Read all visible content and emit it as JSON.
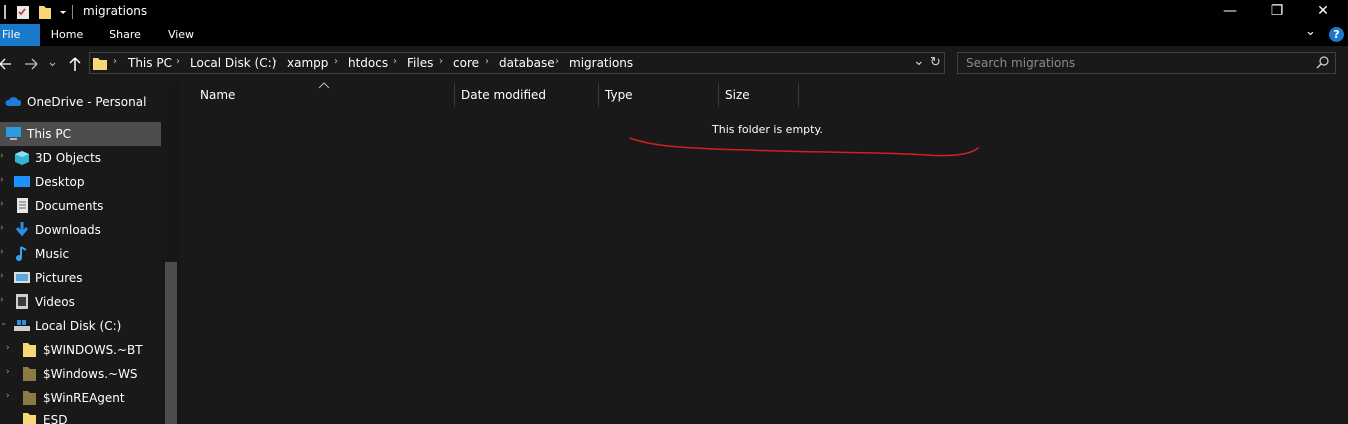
{
  "window": {
    "title": "migrations",
    "minimize": "—",
    "maximize": "❐",
    "close": "✕"
  },
  "ribbon": {
    "tabs": [
      "File",
      "Home",
      "Share",
      "View"
    ],
    "help": "?",
    "expand": "⌄"
  },
  "address": {
    "breadcrumbs": [
      "This PC",
      "Local Disk (C:)",
      "xampp",
      "htdocs",
      "Files",
      "core",
      "database",
      "migrations"
    ],
    "dropdown": "⌄",
    "refresh": "↻"
  },
  "search": {
    "placeholder": "Search migrations"
  },
  "nav": {
    "items": [
      {
        "label": "OneDrive - Personal",
        "icon": "cloud-icon"
      },
      {
        "label": "This PC",
        "icon": "computer-icon"
      },
      {
        "label": "3D Objects",
        "icon": "cube-icon"
      },
      {
        "label": "Desktop",
        "icon": "desktop-icon"
      },
      {
        "label": "Documents",
        "icon": "document-icon"
      },
      {
        "label": "Downloads",
        "icon": "download-icon"
      },
      {
        "label": "Music",
        "icon": "music-icon"
      },
      {
        "label": "Pictures",
        "icon": "picture-icon"
      },
      {
        "label": "Videos",
        "icon": "video-icon"
      },
      {
        "label": "Local Disk (C:)",
        "icon": "drive-icon"
      },
      {
        "label": "$WINDOWS.~BT",
        "icon": "folder-icon"
      },
      {
        "label": "$Windows.~WS",
        "icon": "folder-icon"
      },
      {
        "label": "$WinREAgent",
        "icon": "folder-icon"
      },
      {
        "label": "ESD",
        "icon": "folder-icon"
      }
    ]
  },
  "columns": [
    "Name",
    "Date modified",
    "Type",
    "Size"
  ],
  "content": {
    "empty_message": "This folder is empty."
  }
}
